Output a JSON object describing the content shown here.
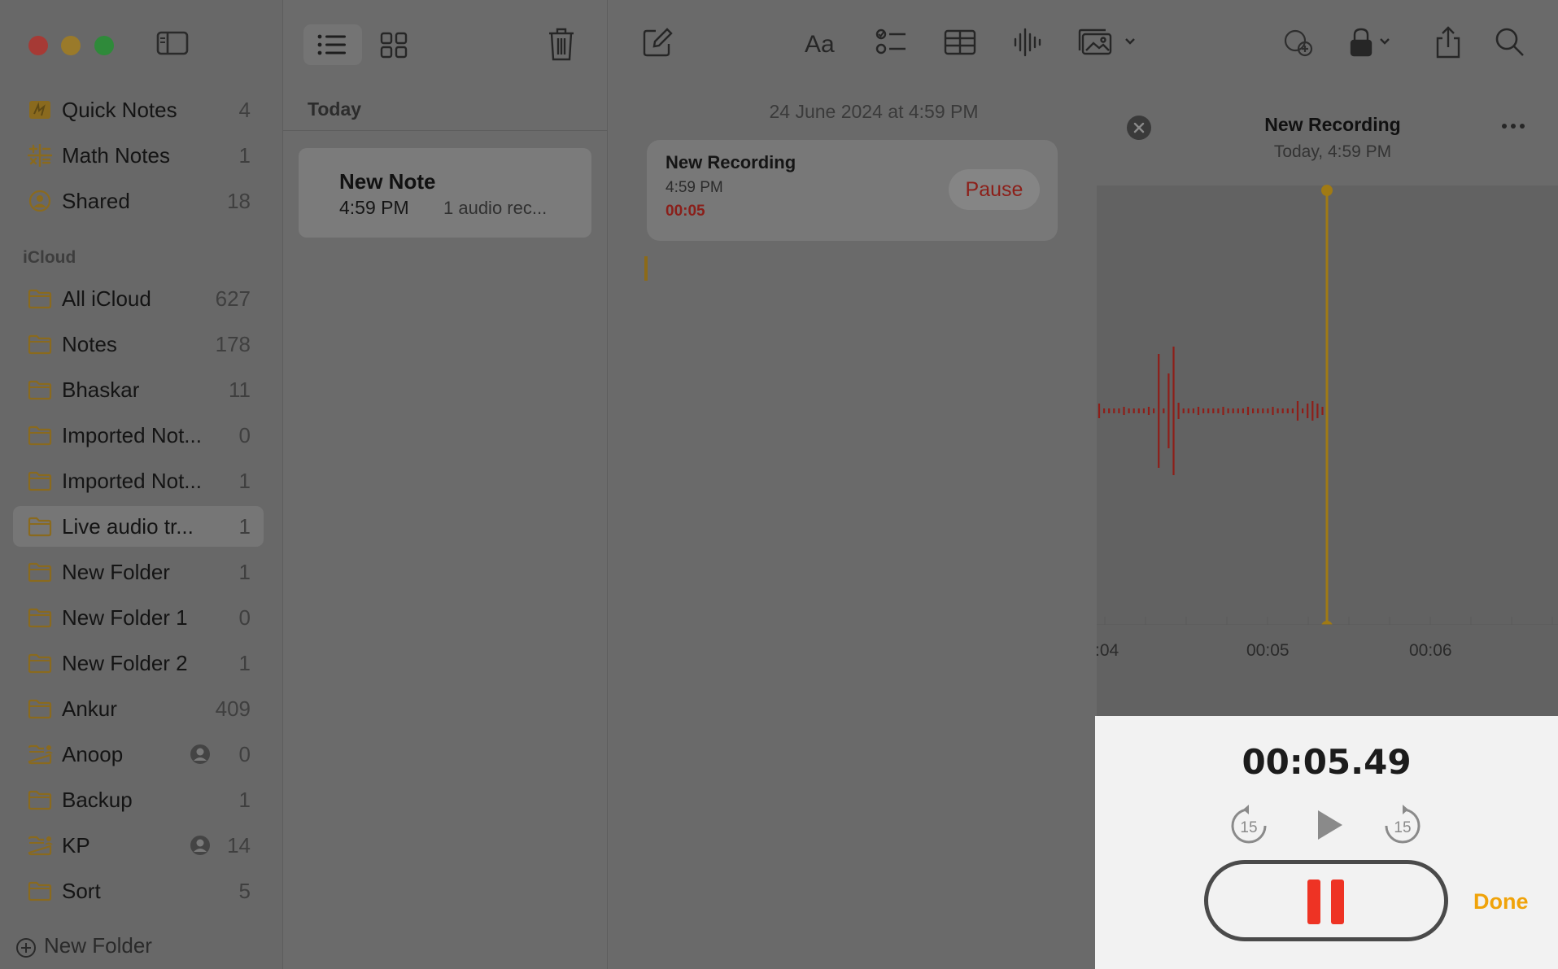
{
  "sidebar": {
    "pinned": [
      {
        "label": "Quick Notes",
        "count": "4",
        "icon": "quick-notes-icon"
      },
      {
        "label": "Math Notes",
        "count": "1",
        "icon": "math-notes-icon"
      },
      {
        "label": "Shared",
        "count": "18",
        "icon": "shared-icon"
      }
    ],
    "section_label": "iCloud",
    "folders": [
      {
        "label": "All iCloud",
        "count": "627",
        "shared": false,
        "selected": false
      },
      {
        "label": "Notes",
        "count": "178",
        "shared": false,
        "selected": false
      },
      {
        "label": "Bhaskar",
        "count": "11",
        "shared": false,
        "selected": false
      },
      {
        "label": "Imported Not...",
        "count": "0",
        "shared": false,
        "selected": false
      },
      {
        "label": "Imported Not...",
        "count": "1",
        "shared": false,
        "selected": false
      },
      {
        "label": "Live audio tr...",
        "count": "1",
        "shared": false,
        "selected": true
      },
      {
        "label": "New Folder",
        "count": "1",
        "shared": false,
        "selected": false
      },
      {
        "label": "New Folder 1",
        "count": "0",
        "shared": false,
        "selected": false
      },
      {
        "label": "New Folder 2",
        "count": "1",
        "shared": false,
        "selected": false
      },
      {
        "label": "Ankur",
        "count": "409",
        "shared": false,
        "selected": false
      },
      {
        "label": "Anoop",
        "count": "0",
        "shared": true,
        "selected": false
      },
      {
        "label": "Backup",
        "count": "1",
        "shared": false,
        "selected": false
      },
      {
        "label": "KP",
        "count": "14",
        "shared": true,
        "selected": false
      },
      {
        "label": "Sort",
        "count": "5",
        "shared": false,
        "selected": false
      }
    ],
    "new_folder_label": "New Folder"
  },
  "note_list": {
    "header": "Today",
    "notes": [
      {
        "title": "New Note",
        "time": "4:59 PM",
        "preview": "1 audio rec..."
      }
    ]
  },
  "editor": {
    "date_line": "24 June 2024 at 4:59 PM",
    "recording_card": {
      "title": "New Recording",
      "time": "4:59 PM",
      "elapsed": "00:05",
      "pause_label": "Pause"
    }
  },
  "recording_panel": {
    "title": "New Recording",
    "subtitle": "Today, 4:59 PM",
    "timeline_labels": [
      ":04",
      "00:05",
      "00:06"
    ],
    "timer": "00:05.49",
    "skip_back_label": "15",
    "skip_forward_label": "15",
    "done_label": "Done"
  },
  "colors": {
    "accent_yellow": "#f0a30a",
    "record_red": "#ee3324",
    "waveform_red": "#8e1e18",
    "playhead": "#a07a14"
  }
}
